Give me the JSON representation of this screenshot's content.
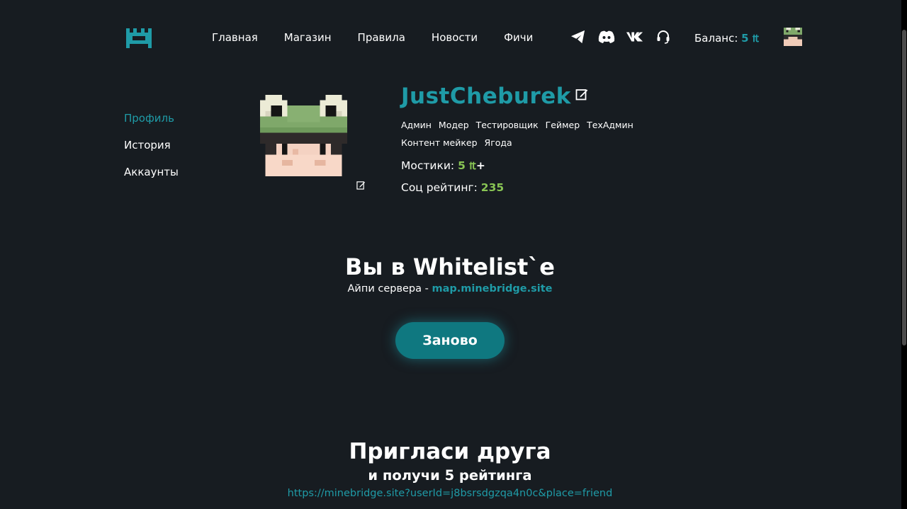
{
  "header": {
    "nav": [
      "Главная",
      "Магазин",
      "Правила",
      "Новости",
      "Фичи"
    ],
    "socials": [
      "telegram-icon",
      "discord-icon",
      "vk-icon",
      "headset-icon"
    ],
    "balance_label": "Баланс:",
    "balance_amount": "5 ₶"
  },
  "sidebar": {
    "items": [
      "Профиль",
      "История",
      "Аккаунты"
    ],
    "active": "Профиль"
  },
  "profile": {
    "username": "JustCheburek",
    "roles": [
      "Админ",
      "Модер",
      "Тестировщик",
      "Геймер",
      "ТехАдмин",
      "Контент мейкер",
      "Ягода"
    ],
    "currency_label": "Мостики:",
    "currency_value": "5 ₶",
    "currency_plus": "+",
    "rating_label": "Соц рейтинг:",
    "rating_value": "235"
  },
  "whitelist": {
    "title": "Вы в Whitelist`е",
    "ip_label": "Айпи сервера -",
    "ip_value": "map.minebridge.site",
    "button": "Заново"
  },
  "invite": {
    "title": "Пригласи друга",
    "subtitle": "и получи 5 рейтинга",
    "link": "https://minebridge.site?userId=j8bsrsdgzqa4n0c&place=friend"
  },
  "colors": {
    "background": "#171c21",
    "accent": "#1f9ba7",
    "green": "#88c454",
    "button": "#0f7880"
  }
}
